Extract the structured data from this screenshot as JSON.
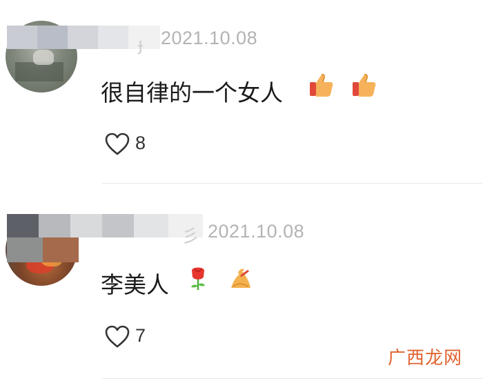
{
  "comments": [
    {
      "timestamp": "2021.10.08",
      "name_tail": "ɟ",
      "text": "很自律的一个女人",
      "emojis": [
        "thumbs-up-icon",
        "thumbs-up-icon"
      ],
      "likes": "8"
    },
    {
      "timestamp": "2021.10.08",
      "name_tail": "彡",
      "text": "李美人",
      "emojis": [
        "rose-icon",
        "fortune-cookie-icon"
      ],
      "likes": "7"
    }
  ],
  "watermark": "广西龙网",
  "colors": {
    "timestamp": "#b3b3b3",
    "text": "#1a1a1a",
    "watermark": "#e0632f"
  }
}
